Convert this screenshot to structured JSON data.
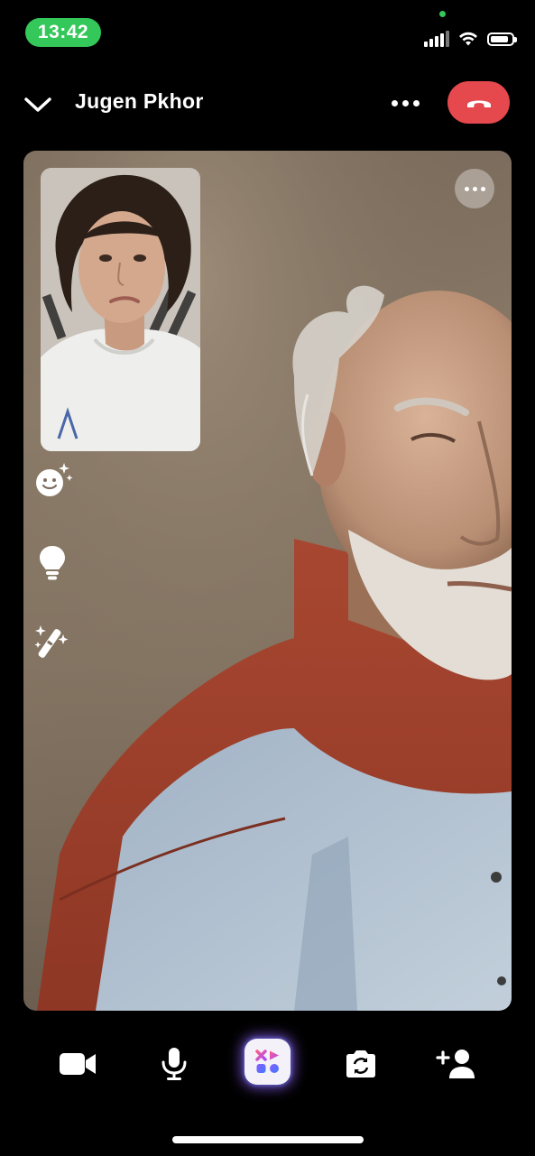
{
  "status_bar": {
    "time": "13:42",
    "signal_bars": 4,
    "battery_level": 0.85
  },
  "header": {
    "contact_name": "Jugen  Pkhor"
  },
  "colors": {
    "end_call": "#e5484d",
    "status_green": "#34c759",
    "scarf": "#b24a33",
    "shirt": "#a4b6c8"
  },
  "icons": {
    "back": "chevron-down-icon",
    "more": "ellipsis-icon",
    "end_call": "phone-hangup-icon",
    "effects": "face-sparkle-icon",
    "tips": "lightbulb-icon",
    "magic": "magic-wand-icon",
    "camera": "video-camera-icon",
    "mic": "microphone-icon",
    "apps": "apps-grid-icon",
    "flip": "flip-camera-icon",
    "add_person": "add-person-icon"
  }
}
